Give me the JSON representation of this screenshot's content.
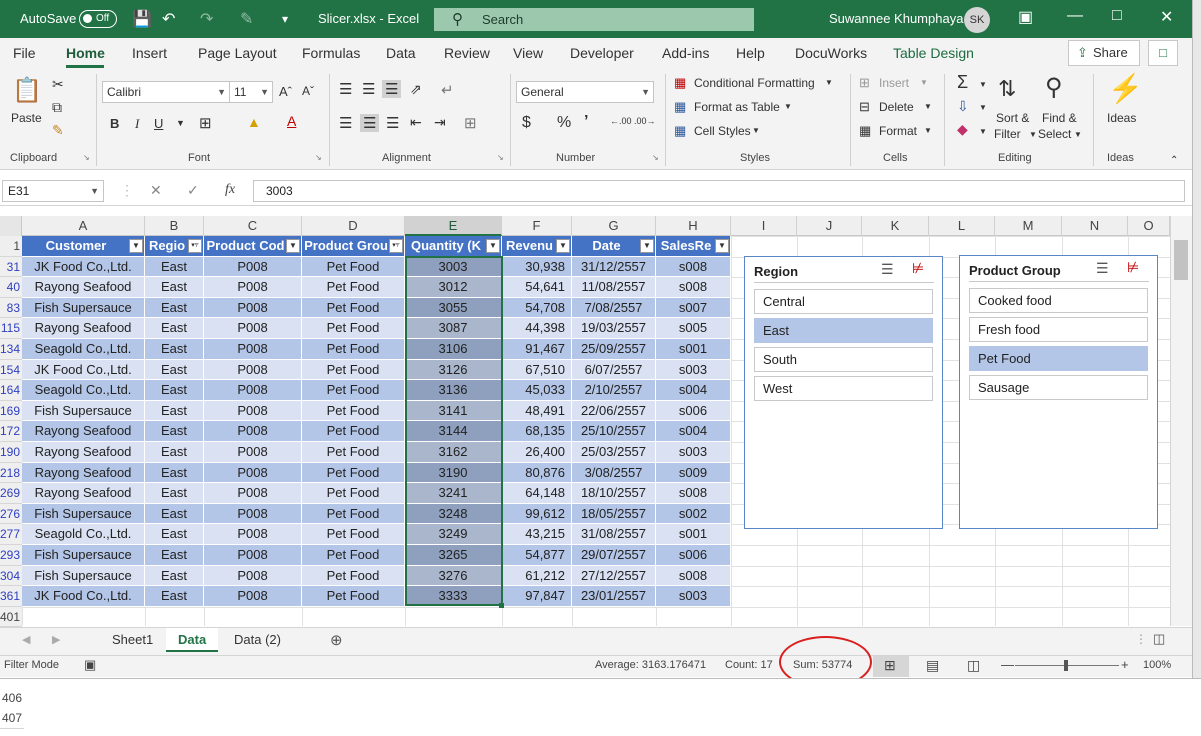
{
  "titlebar": {
    "autosave": "AutoSave",
    "toggle": "Off",
    "file_title": "Slicer.xlsx  -  Excel",
    "search": "Search",
    "user": "Suwannee Khumphaya",
    "avatar": "SK"
  },
  "menu": {
    "items": [
      "File",
      "Home",
      "Insert",
      "Page Layout",
      "Formulas",
      "Data",
      "Review",
      "View",
      "Developer",
      "Add-ins",
      "Help",
      "DocuWorks",
      "Table Design"
    ],
    "share": "Share"
  },
  "ribbon": {
    "clipboard": {
      "paste": "Paste",
      "label": "Clipboard"
    },
    "font": {
      "name": "Calibri",
      "size": "11",
      "label": "Font"
    },
    "alignment": {
      "label": "Alignment"
    },
    "number": {
      "format": "General",
      "label": "Number"
    },
    "styles": {
      "conditional": "Conditional Formatting",
      "format_table": "Format as Table",
      "cell_styles": "Cell Styles",
      "label": "Styles"
    },
    "cells": {
      "insert": "Insert",
      "delete": "Delete",
      "format": "Format",
      "label": "Cells"
    },
    "editing": {
      "sort": "Sort &",
      "filter": "Filter",
      "find": "Find &",
      "select": "Select",
      "label": "Editing"
    },
    "ideas": {
      "ideas": "Ideas",
      "label": "Ideas"
    }
  },
  "formula_bar": {
    "name_box": "E31",
    "value": "3003"
  },
  "columns": [
    "A",
    "B",
    "C",
    "D",
    "E",
    "F",
    "G",
    "H",
    "I",
    "J",
    "K",
    "L",
    "M",
    "N",
    "O"
  ],
  "table_headers": [
    "Customer",
    "Regio",
    "Product Cod",
    "Product Grou",
    "Quantity (K",
    "Revenu",
    "Date",
    "SalesRe"
  ],
  "rows": [
    {
      "rownum": "31",
      "customer": "JK Food Co.,Ltd.",
      "region": "East",
      "code": "P008",
      "group": "Pet Food",
      "qty": "3003",
      "revenue": "30,938",
      "date": "31/12/2557",
      "sales": "s008"
    },
    {
      "rownum": "40",
      "customer": "Rayong Seafood",
      "region": "East",
      "code": "P008",
      "group": "Pet Food",
      "qty": "3012",
      "revenue": "54,641",
      "date": "11/08/2557",
      "sales": "s008"
    },
    {
      "rownum": "83",
      "customer": "Fish Supersauce",
      "region": "East",
      "code": "P008",
      "group": "Pet Food",
      "qty": "3055",
      "revenue": "54,708",
      "date": "7/08/2557",
      "sales": "s007"
    },
    {
      "rownum": "115",
      "customer": "Rayong Seafood",
      "region": "East",
      "code": "P008",
      "group": "Pet Food",
      "qty": "3087",
      "revenue": "44,398",
      "date": "19/03/2557",
      "sales": "s005"
    },
    {
      "rownum": "134",
      "customer": "Seagold Co.,Ltd.",
      "region": "East",
      "code": "P008",
      "group": "Pet Food",
      "qty": "3106",
      "revenue": "91,467",
      "date": "25/09/2557",
      "sales": "s001"
    },
    {
      "rownum": "154",
      "customer": "JK Food Co.,Ltd.",
      "region": "East",
      "code": "P008",
      "group": "Pet Food",
      "qty": "3126",
      "revenue": "67,510",
      "date": "6/07/2557",
      "sales": "s003"
    },
    {
      "rownum": "164",
      "customer": "Seagold Co.,Ltd.",
      "region": "East",
      "code": "P008",
      "group": "Pet Food",
      "qty": "3136",
      "revenue": "45,033",
      "date": "2/10/2557",
      "sales": "s004"
    },
    {
      "rownum": "169",
      "customer": "Fish Supersauce",
      "region": "East",
      "code": "P008",
      "group": "Pet Food",
      "qty": "3141",
      "revenue": "48,491",
      "date": "22/06/2557",
      "sales": "s006"
    },
    {
      "rownum": "172",
      "customer": "Rayong Seafood",
      "region": "East",
      "code": "P008",
      "group": "Pet Food",
      "qty": "3144",
      "revenue": "68,135",
      "date": "25/10/2557",
      "sales": "s004"
    },
    {
      "rownum": "190",
      "customer": "Rayong Seafood",
      "region": "East",
      "code": "P008",
      "group": "Pet Food",
      "qty": "3162",
      "revenue": "26,400",
      "date": "25/03/2557",
      "sales": "s003"
    },
    {
      "rownum": "218",
      "customer": "Rayong Seafood",
      "region": "East",
      "code": "P008",
      "group": "Pet Food",
      "qty": "3190",
      "revenue": "80,876",
      "date": "3/08/2557",
      "sales": "s009"
    },
    {
      "rownum": "269",
      "customer": "Rayong Seafood",
      "region": "East",
      "code": "P008",
      "group": "Pet Food",
      "qty": "3241",
      "revenue": "64,148",
      "date": "18/10/2557",
      "sales": "s008"
    },
    {
      "rownum": "276",
      "customer": "Fish Supersauce",
      "region": "East",
      "code": "P008",
      "group": "Pet Food",
      "qty": "3248",
      "revenue": "99,612",
      "date": "18/05/2557",
      "sales": "s002"
    },
    {
      "rownum": "277",
      "customer": "Seagold Co.,Ltd.",
      "region": "East",
      "code": "P008",
      "group": "Pet Food",
      "qty": "3249",
      "revenue": "43,215",
      "date": "31/08/2557",
      "sales": "s001"
    },
    {
      "rownum": "293",
      "customer": "Fish Supersauce",
      "region": "East",
      "code": "P008",
      "group": "Pet Food",
      "qty": "3265",
      "revenue": "54,877",
      "date": "29/07/2557",
      "sales": "s006"
    },
    {
      "rownum": "304",
      "customer": "Fish Supersauce",
      "region": "East",
      "code": "P008",
      "group": "Pet Food",
      "qty": "3276",
      "revenue": "61,212",
      "date": "27/12/2557",
      "sales": "s008"
    },
    {
      "rownum": "361",
      "customer": "JK Food Co.,Ltd.",
      "region": "East",
      "code": "P008",
      "group": "Pet Food",
      "qty": "3333",
      "revenue": "97,847",
      "date": "23/01/2557",
      "sales": "s003"
    }
  ],
  "row_header_first": "1",
  "row_header_after": "401",
  "extra_rows": [
    "406",
    "407"
  ],
  "slicer_region": {
    "title": "Region",
    "items": [
      "Central",
      "East",
      "South",
      "West"
    ],
    "selected": "East"
  },
  "slicer_group": {
    "title": "Product Group",
    "items": [
      "Cooked food",
      "Fresh food",
      "Pet Food",
      "Sausage"
    ],
    "selected": "Pet Food"
  },
  "sheets": [
    "Sheet1",
    "Data",
    "Data (2)"
  ],
  "active_sheet": "Data",
  "status": {
    "mode": "Filter Mode",
    "average": "Average: 3163.176471",
    "count": "Count: 17",
    "sum": "Sum: 53774",
    "zoom": "100%"
  },
  "colors": {
    "excel_green": "#217346",
    "header_blue": "#4472c4",
    "band_dark": "#b4c6e7",
    "band_light": "#d9e1f2",
    "highlight_red": "#d92020"
  }
}
